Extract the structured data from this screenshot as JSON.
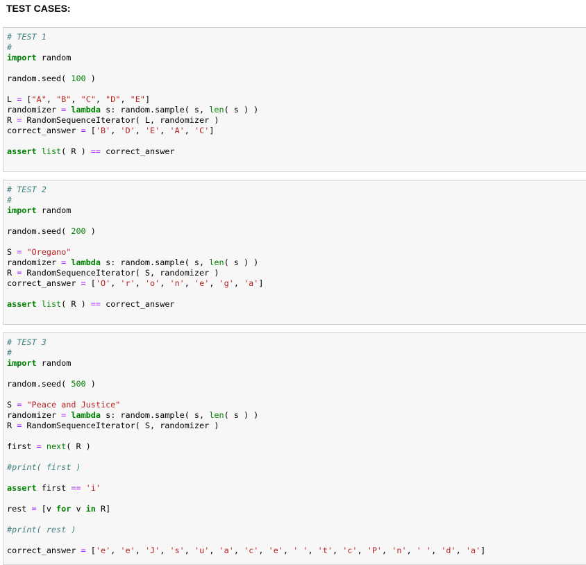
{
  "page": {
    "heading": "TEST CASES:"
  },
  "cells": [
    {
      "lines": [
        [
          {
            "t": "# TEST 1",
            "c": "c"
          }
        ],
        [
          {
            "t": "#",
            "c": "c"
          }
        ],
        [
          {
            "t": "import",
            "c": "k"
          },
          {
            "t": " random"
          }
        ],
        [],
        [
          {
            "t": "random.seed( "
          },
          {
            "t": "100",
            "c": "n"
          },
          {
            "t": " )"
          }
        ],
        [],
        [
          {
            "t": "L "
          },
          {
            "t": "=",
            "c": "o"
          },
          {
            "t": " ["
          },
          {
            "t": "\"A\"",
            "c": "s"
          },
          {
            "t": ", "
          },
          {
            "t": "\"B\"",
            "c": "s"
          },
          {
            "t": ", "
          },
          {
            "t": "\"C\"",
            "c": "s"
          },
          {
            "t": ", "
          },
          {
            "t": "\"D\"",
            "c": "s"
          },
          {
            "t": ", "
          },
          {
            "t": "\"E\"",
            "c": "s"
          },
          {
            "t": "]"
          }
        ],
        [
          {
            "t": "randomizer "
          },
          {
            "t": "=",
            "c": "o"
          },
          {
            "t": " "
          },
          {
            "t": "lambda",
            "c": "k"
          },
          {
            "t": " s: random.sample( s, "
          },
          {
            "t": "len",
            "c": "b"
          },
          {
            "t": "( s ) )"
          }
        ],
        [
          {
            "t": "R "
          },
          {
            "t": "=",
            "c": "o"
          },
          {
            "t": " RandomSequenceIterator( L, randomizer )"
          }
        ],
        [
          {
            "t": "correct_answer "
          },
          {
            "t": "=",
            "c": "o"
          },
          {
            "t": " ["
          },
          {
            "t": "'B'",
            "c": "s"
          },
          {
            "t": ", "
          },
          {
            "t": "'D'",
            "c": "s"
          },
          {
            "t": ", "
          },
          {
            "t": "'E'",
            "c": "s"
          },
          {
            "t": ", "
          },
          {
            "t": "'A'",
            "c": "s"
          },
          {
            "t": ", "
          },
          {
            "t": "'C'",
            "c": "s"
          },
          {
            "t": "]"
          }
        ],
        [],
        [
          {
            "t": "assert",
            "c": "k"
          },
          {
            "t": " "
          },
          {
            "t": "list",
            "c": "b"
          },
          {
            "t": "( R ) "
          },
          {
            "t": "==",
            "c": "o"
          },
          {
            "t": " correct_answer"
          }
        ]
      ]
    },
    {
      "lines": [
        [
          {
            "t": "# TEST 2",
            "c": "c"
          }
        ],
        [
          {
            "t": "#",
            "c": "c"
          }
        ],
        [
          {
            "t": "import",
            "c": "k"
          },
          {
            "t": " random"
          }
        ],
        [],
        [
          {
            "t": "random.seed( "
          },
          {
            "t": "200",
            "c": "n"
          },
          {
            "t": " )"
          }
        ],
        [],
        [
          {
            "t": "S "
          },
          {
            "t": "=",
            "c": "o"
          },
          {
            "t": " "
          },
          {
            "t": "\"Oregano\"",
            "c": "s"
          }
        ],
        [
          {
            "t": "randomizer "
          },
          {
            "t": "=",
            "c": "o"
          },
          {
            "t": " "
          },
          {
            "t": "lambda",
            "c": "k"
          },
          {
            "t": " s: random.sample( s, "
          },
          {
            "t": "len",
            "c": "b"
          },
          {
            "t": "( s ) )"
          }
        ],
        [
          {
            "t": "R "
          },
          {
            "t": "=",
            "c": "o"
          },
          {
            "t": " RandomSequenceIterator( S, randomizer )"
          }
        ],
        [
          {
            "t": "correct_answer "
          },
          {
            "t": "=",
            "c": "o"
          },
          {
            "t": " ["
          },
          {
            "t": "'O'",
            "c": "s"
          },
          {
            "t": ", "
          },
          {
            "t": "'r'",
            "c": "s"
          },
          {
            "t": ", "
          },
          {
            "t": "'o'",
            "c": "s"
          },
          {
            "t": ", "
          },
          {
            "t": "'n'",
            "c": "s"
          },
          {
            "t": ", "
          },
          {
            "t": "'e'",
            "c": "s"
          },
          {
            "t": ", "
          },
          {
            "t": "'g'",
            "c": "s"
          },
          {
            "t": ", "
          },
          {
            "t": "'a'",
            "c": "s"
          },
          {
            "t": "]"
          }
        ],
        [],
        [
          {
            "t": "assert",
            "c": "k"
          },
          {
            "t": " "
          },
          {
            "t": "list",
            "c": "b"
          },
          {
            "t": "( R ) "
          },
          {
            "t": "==",
            "c": "o"
          },
          {
            "t": " correct_answer"
          }
        ]
      ]
    },
    {
      "lines": [
        [
          {
            "t": "# TEST 3",
            "c": "c"
          }
        ],
        [
          {
            "t": "#",
            "c": "c"
          }
        ],
        [
          {
            "t": "import",
            "c": "k"
          },
          {
            "t": " random"
          }
        ],
        [],
        [
          {
            "t": "random.seed( "
          },
          {
            "t": "500",
            "c": "n"
          },
          {
            "t": " )"
          }
        ],
        [],
        [
          {
            "t": "S "
          },
          {
            "t": "=",
            "c": "o"
          },
          {
            "t": " "
          },
          {
            "t": "\"Peace and Justice\"",
            "c": "s"
          }
        ],
        [
          {
            "t": "randomizer "
          },
          {
            "t": "=",
            "c": "o"
          },
          {
            "t": " "
          },
          {
            "t": "lambda",
            "c": "k"
          },
          {
            "t": " s: random.sample( s, "
          },
          {
            "t": "len",
            "c": "b"
          },
          {
            "t": "( s ) )"
          }
        ],
        [
          {
            "t": "R "
          },
          {
            "t": "=",
            "c": "o"
          },
          {
            "t": " RandomSequenceIterator( S, randomizer )"
          }
        ],
        [],
        [
          {
            "t": "first "
          },
          {
            "t": "=",
            "c": "o"
          },
          {
            "t": " "
          },
          {
            "t": "next",
            "c": "b"
          },
          {
            "t": "( R )"
          }
        ],
        [],
        [
          {
            "t": "#print( first )",
            "c": "c"
          }
        ],
        [],
        [
          {
            "t": "assert",
            "c": "k"
          },
          {
            "t": " first "
          },
          {
            "t": "==",
            "c": "o"
          },
          {
            "t": " "
          },
          {
            "t": "'i'",
            "c": "s"
          }
        ],
        [],
        [
          {
            "t": "rest "
          },
          {
            "t": "=",
            "c": "o"
          },
          {
            "t": " [v "
          },
          {
            "t": "for",
            "c": "k"
          },
          {
            "t": " v "
          },
          {
            "t": "in",
            "c": "k"
          },
          {
            "t": " R]"
          }
        ],
        [],
        [
          {
            "t": "#print( rest )",
            "c": "c"
          }
        ],
        [],
        [
          {
            "t": "correct_answer "
          },
          {
            "t": "=",
            "c": "o"
          },
          {
            "t": " ["
          },
          {
            "t": "'e'",
            "c": "s"
          },
          {
            "t": ", "
          },
          {
            "t": "'e'",
            "c": "s"
          },
          {
            "t": ", "
          },
          {
            "t": "'J'",
            "c": "s"
          },
          {
            "t": ", "
          },
          {
            "t": "'s'",
            "c": "s"
          },
          {
            "t": ", "
          },
          {
            "t": "'u'",
            "c": "s"
          },
          {
            "t": ", "
          },
          {
            "t": "'a'",
            "c": "s"
          },
          {
            "t": ", "
          },
          {
            "t": "'c'",
            "c": "s"
          },
          {
            "t": ", "
          },
          {
            "t": "'e'",
            "c": "s"
          },
          {
            "t": ", "
          },
          {
            "t": "' '",
            "c": "s"
          },
          {
            "t": ", "
          },
          {
            "t": "'t'",
            "c": "s"
          },
          {
            "t": ", "
          },
          {
            "t": "'c'",
            "c": "s"
          },
          {
            "t": ", "
          },
          {
            "t": "'P'",
            "c": "s"
          },
          {
            "t": ", "
          },
          {
            "t": "'n'",
            "c": "s"
          },
          {
            "t": ", "
          },
          {
            "t": "' '",
            "c": "s"
          },
          {
            "t": ", "
          },
          {
            "t": "'d'",
            "c": "s"
          },
          {
            "t": ", "
          },
          {
            "t": "'a'",
            "c": "s"
          },
          {
            "t": "]"
          }
        ]
      ]
    }
  ]
}
